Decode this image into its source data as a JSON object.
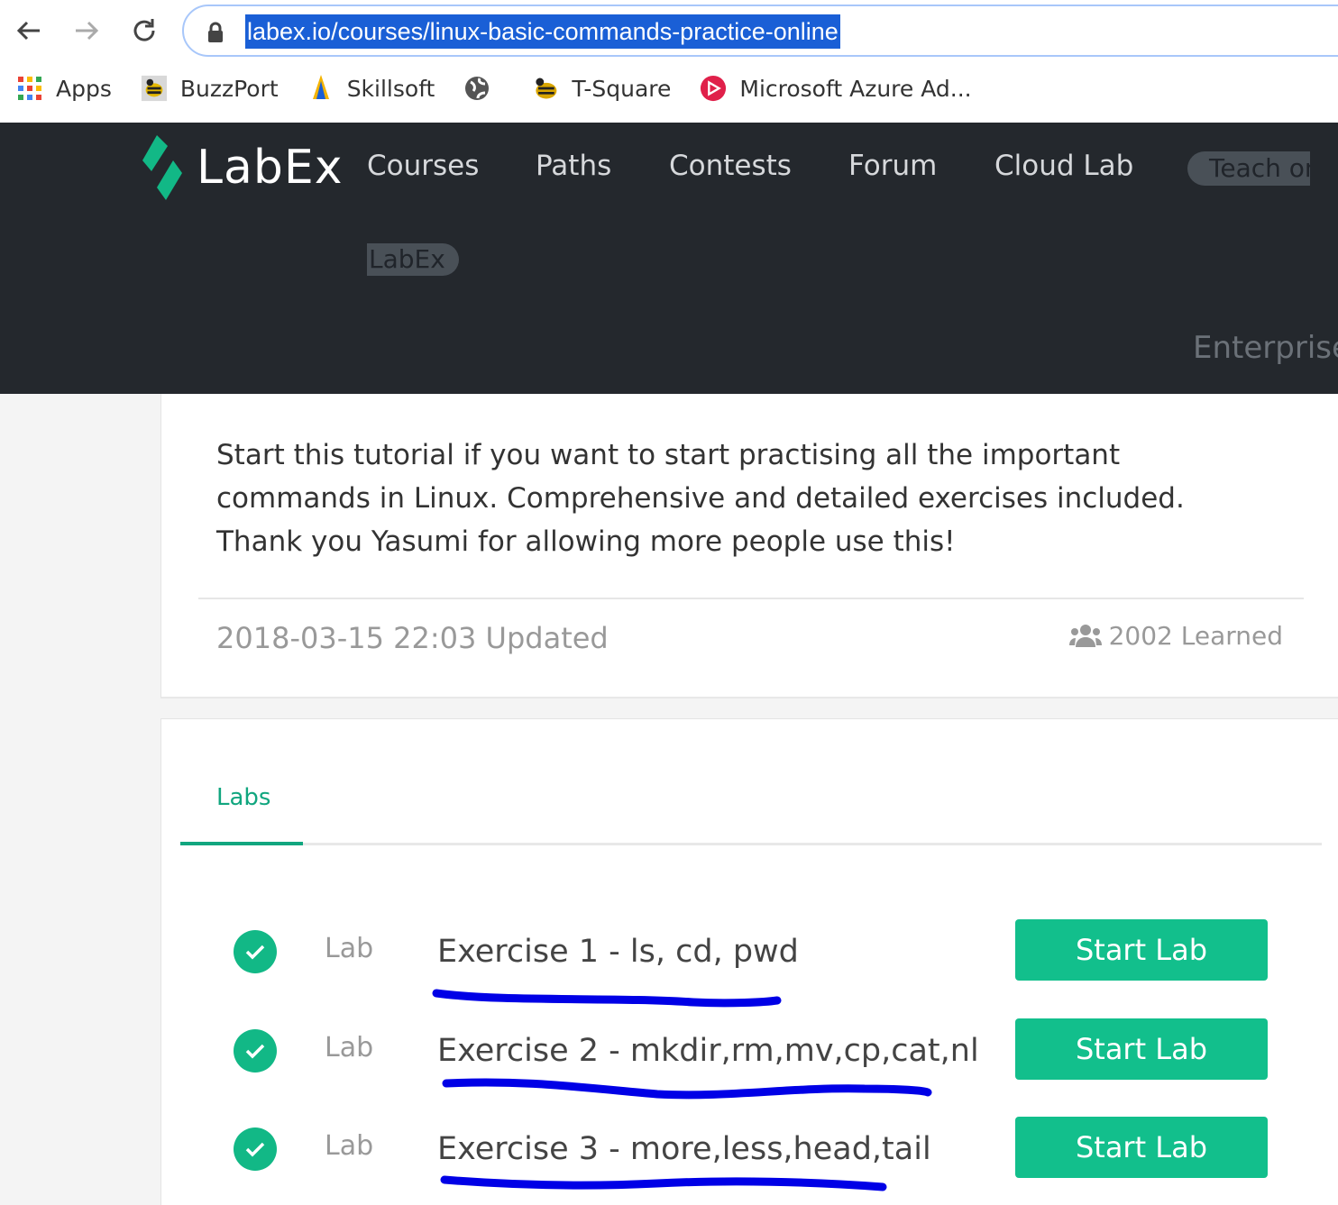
{
  "browser": {
    "url": "labex.io/courses/linux-basic-commands-practice-online",
    "bookmarks": [
      {
        "label": "Apps",
        "icon": "apps-grid-icon"
      },
      {
        "label": "BuzzPort",
        "icon": "buzz-icon"
      },
      {
        "label": "Skillsoft",
        "icon": "skillsoft-icon"
      },
      {
        "label": "",
        "icon": "globe-icon"
      },
      {
        "label": "T-Square",
        "icon": "tsquare-icon"
      },
      {
        "label": "Microsoft Azure Ad...",
        "icon": "azure-icon"
      }
    ]
  },
  "header": {
    "logo": "LabEx",
    "nav": [
      "Courses",
      "Paths",
      "Contests",
      "Forum",
      "Cloud Lab"
    ],
    "teach_pill_1": "Teach on",
    "teach_pill_2": "LabEx",
    "enterprise": "Enterprise"
  },
  "course": {
    "description": "Start this tutorial if you want to start practising all the important commands in Linux. Comprehensive and detailed exercises included. Thank you Yasumi for allowing more people use this!",
    "updated": "2018-03-15 22:03 Updated",
    "learned": "2002 Learned"
  },
  "labs": {
    "tab_label": "Labs",
    "items": [
      {
        "tag": "Lab",
        "title": "Exercise 1 - ls, cd, pwd",
        "button": "Start Lab"
      },
      {
        "tag": "Lab",
        "title": "Exercise 2 - mkdir,rm,mv,cp,cat,nl",
        "button": "Start Lab"
      },
      {
        "tag": "Lab",
        "title": "Exercise 3 - more,less,head,tail",
        "button": "Start Lab"
      }
    ]
  },
  "colors": {
    "accent": "#12b886",
    "header_bg": "#24282d",
    "annotation": "#0000e6"
  }
}
